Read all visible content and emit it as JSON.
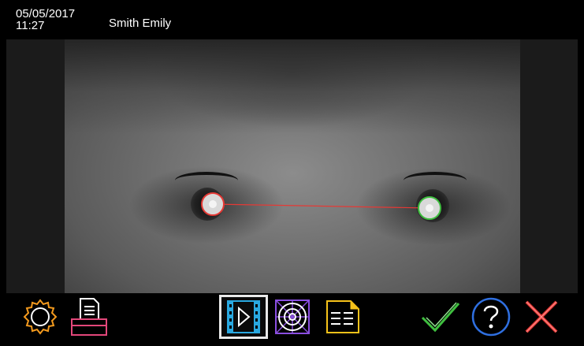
{
  "header": {
    "date": "05/05/2017",
    "time": "11:27",
    "patient_name": "Smith Emily"
  },
  "measurement": {
    "left_eye_marker_color": "#e53935",
    "right_eye_marker_color": "#3fbf3f",
    "line_color": "#e53935"
  },
  "toolbar": {
    "items": [
      {
        "name": "settings",
        "icon": "gear-icon",
        "color": "#f39a1e",
        "active": false
      },
      {
        "name": "print",
        "icon": "printer-icon",
        "color": "#e3477a",
        "active": false
      },
      {
        "name": "play",
        "icon": "play-film-icon",
        "color": "#29a8e0",
        "active": true
      },
      {
        "name": "target",
        "icon": "target-icon",
        "color": "#8a4ee0",
        "active": false
      },
      {
        "name": "report",
        "icon": "report-icon",
        "color": "#f6c21a",
        "active": false
      },
      {
        "name": "accept",
        "icon": "check-icon",
        "color": "#3fbf3f",
        "active": false
      },
      {
        "name": "help",
        "icon": "help-icon",
        "color": "#2f6fe0",
        "active": false
      },
      {
        "name": "close",
        "icon": "close-icon",
        "color": "#e53935",
        "active": false
      }
    ]
  }
}
